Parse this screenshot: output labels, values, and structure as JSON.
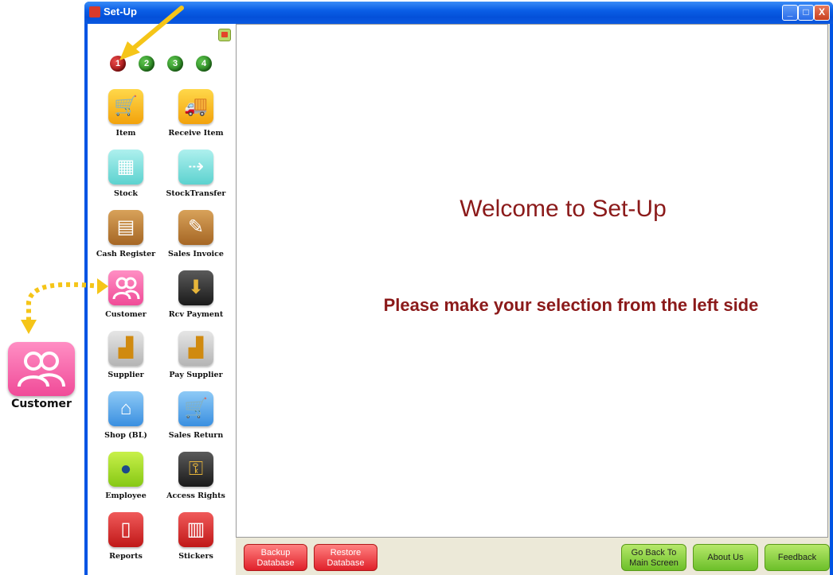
{
  "window": {
    "title": "Set-Up",
    "minimize_label": "_",
    "maximize_label": "□",
    "close_label": "X"
  },
  "pages": [
    "1",
    "2",
    "3",
    "4"
  ],
  "active_page": "1",
  "tiles": [
    {
      "label": "Item",
      "icon": "shopping-cart-icon",
      "color": "#f2a20c"
    },
    {
      "label": "Receive Item",
      "icon": "delivery-truck-icon",
      "color": "#f2a20c"
    },
    {
      "label": "Stock",
      "icon": "hand-truck-icon",
      "color": "#5cd2cf"
    },
    {
      "label": "StockTransfer",
      "icon": "box-transfer-icon",
      "color": "#5cd2cf"
    },
    {
      "label": "Cash Register",
      "icon": "cash-register-icon",
      "color": "#a56624"
    },
    {
      "label": "Sales Invoice",
      "icon": "invoice-pencil-icon",
      "color": "#a56624"
    },
    {
      "label": "Customer",
      "icon": "customer-people-icon",
      "color": "#f04b98"
    },
    {
      "label": "Rcv Payment",
      "icon": "money-bag-icon",
      "color": "#1a1a1a"
    },
    {
      "label": "Supplier",
      "icon": "factory-icon",
      "color": "#b4b4b4"
    },
    {
      "label": "Pay Supplier",
      "icon": "factory-pay-icon",
      "color": "#b4b4b4"
    },
    {
      "label": "Shop (BL)",
      "icon": "shop-icon",
      "color": "#3a8fe0"
    },
    {
      "label": "Sales Return",
      "icon": "cart-return-icon",
      "color": "#3a8fe0"
    },
    {
      "label": "Employee",
      "icon": "employee-person-icon",
      "color": "#86c814"
    },
    {
      "label": "Access Rights",
      "icon": "lock-key-icon",
      "color": "#1a1a1a"
    },
    {
      "label": "Reports",
      "icon": "report-scroll-icon",
      "color": "#c01818"
    },
    {
      "label": "Stickers",
      "icon": "barcode-sticker-icon",
      "color": "#c01818"
    }
  ],
  "main": {
    "welcome_title": "Welcome to Set-Up",
    "instruction": "Please make your selection from the left side"
  },
  "buttons": {
    "backup": [
      "Backup",
      "Database"
    ],
    "restore": [
      "Restore",
      "Database"
    ],
    "go_back": [
      "Go Back To",
      "Main Screen"
    ],
    "about": "About Us",
    "feedback": "Feedback"
  },
  "callout": {
    "label": "Customer",
    "arrow_color": "#f5c518"
  }
}
